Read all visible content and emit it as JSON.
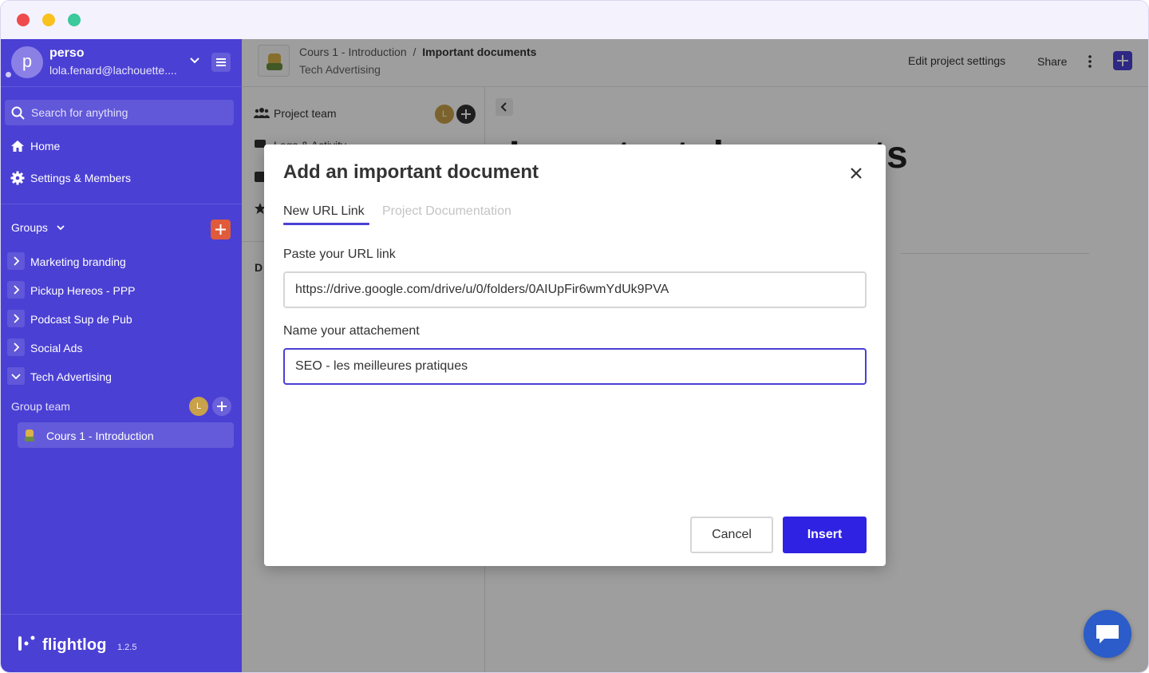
{
  "sidebar": {
    "account_initial": "p",
    "account_name": "perso",
    "account_email": "lola.fenard@lachouette....",
    "search_placeholder": "Search for anything",
    "nav": [
      {
        "label": "Home"
      },
      {
        "label": "Settings & Members"
      }
    ],
    "groups_label": "Groups",
    "groups": [
      {
        "label": "Marketing branding",
        "expanded": false
      },
      {
        "label": "Pickup Hereos - PPP",
        "expanded": false
      },
      {
        "label": "Podcast Sup de Pub",
        "expanded": false
      },
      {
        "label": "Social Ads",
        "expanded": false
      },
      {
        "label": "Tech Advertising",
        "expanded": true
      }
    ],
    "group_team_label": "Group team",
    "team_member_initial": "L",
    "project_label": "Cours 1 - Introduction",
    "logo_text": "flightlog",
    "version": "1.2.5"
  },
  "topbar": {
    "breadcrumb_parent": "Cours 1 - Introduction",
    "breadcrumb_separator": "/",
    "breadcrumb_current": "Important documents",
    "subtitle": "Tech Advertising",
    "edit_settings_label": "Edit project settings",
    "share_label": "Share"
  },
  "left_panel": {
    "project_team_label": "Project team",
    "member_initial": "L",
    "partial_row": "Logs & Activity",
    "section_initial": "D"
  },
  "page": {
    "title": "Important documents",
    "title_visible": "ents"
  },
  "modal": {
    "title": "Add an important document",
    "tabs": [
      {
        "label": "New URL Link",
        "active": true
      },
      {
        "label": "Project Documentation",
        "active": false
      }
    ],
    "url_label": "Paste your URL link",
    "url_value": "https://drive.google.com/drive/u/0/folders/0AIUpFir6wmYdUk9PVA",
    "name_label": "Name your attachement",
    "name_value": "SEO - les meilleures pratiques",
    "cancel_label": "Cancel",
    "insert_label": "Insert"
  },
  "colors": {
    "sidebar_bg": "#4b40d4",
    "accent": "#2f22e3",
    "groups_add": "#e05a3c",
    "chat_button": "#2b5cc9"
  }
}
